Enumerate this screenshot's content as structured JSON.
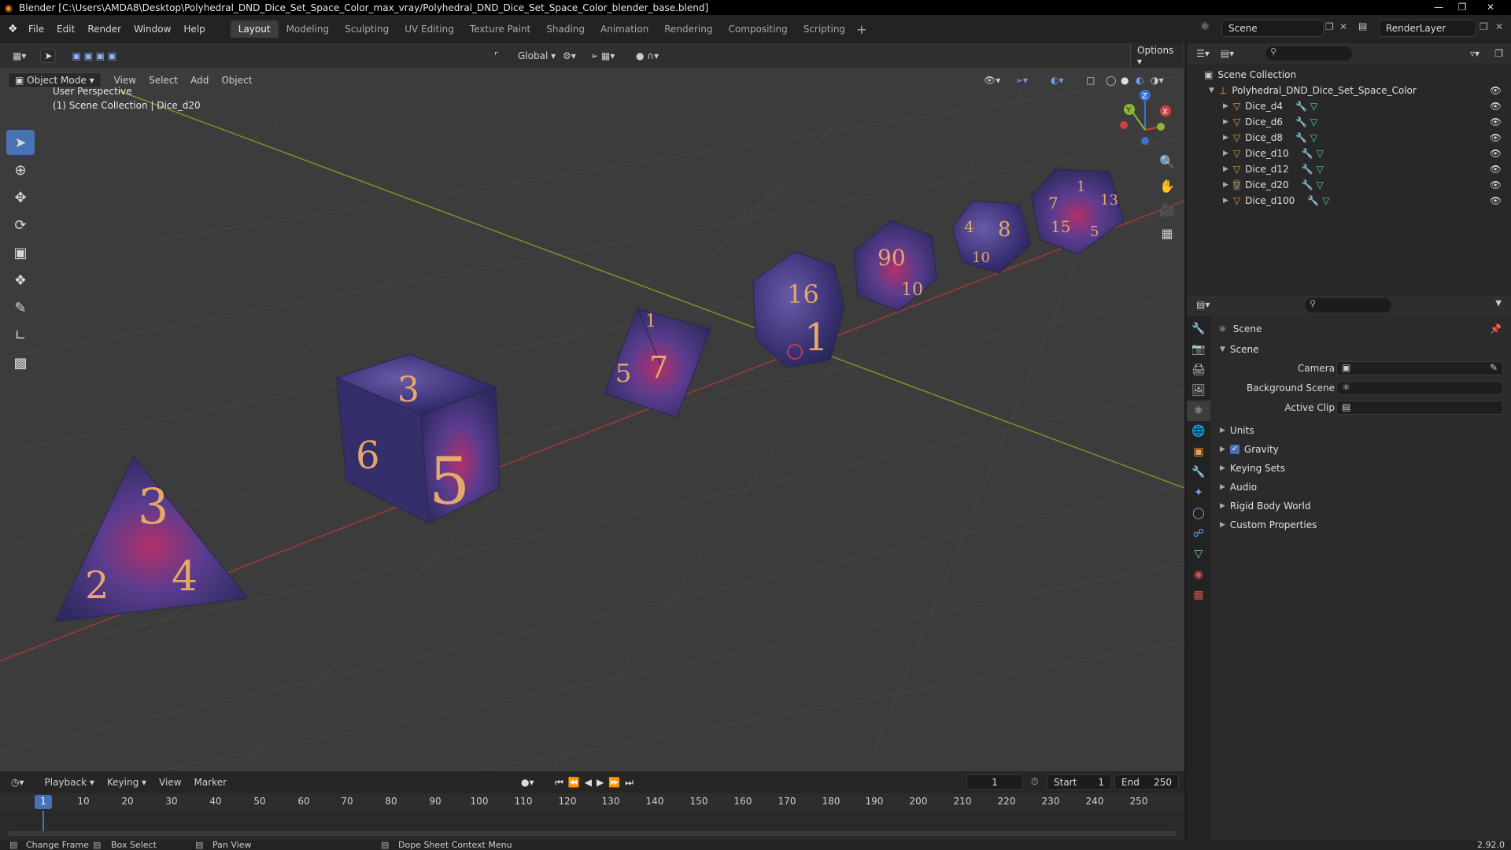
{
  "window": {
    "title": "Blender [C:\\Users\\AMDA8\\Desktop\\Polyhedral_DND_Dice_Set_Space_Color_max_vray/Polyhedral_DND_Dice_Set_Space_Color_blender_base.blend]"
  },
  "menu": {
    "items": [
      "File",
      "Edit",
      "Render",
      "Window",
      "Help"
    ]
  },
  "workspaces": [
    "Layout",
    "Modeling",
    "Sculpting",
    "UV Editing",
    "Texture Paint",
    "Shading",
    "Animation",
    "Rendering",
    "Compositing",
    "Scripting"
  ],
  "top_right": {
    "scene": "Scene",
    "view_layer": "RenderLayer"
  },
  "viewport": {
    "orientation": "Global",
    "options_label": "Options",
    "mode": "Object Mode",
    "header_menus": [
      "View",
      "Select",
      "Add",
      "Object"
    ],
    "perspective": "User Perspective",
    "collection_info": "(1) Scene Collection | Dice_d20"
  },
  "dice_labels": {
    "d4": [
      "3",
      "2",
      "4"
    ],
    "d6": [
      "3",
      "6",
      "5"
    ],
    "d8": [
      "1",
      "5",
      "7"
    ],
    "d20": [
      "16",
      "1"
    ],
    "d10": [
      "90",
      "10"
    ],
    "d12": [
      "4",
      "8",
      "10"
    ],
    "d100": [
      "1",
      "7",
      "15",
      "5",
      "13"
    ]
  },
  "gizmo": {
    "z": "Z",
    "y": "Y",
    "x": "X"
  },
  "outliner": {
    "root": "Scene Collection",
    "collection": "Polyhedral_DND_Dice_Set_Space_Color",
    "objects": [
      "Dice_d4",
      "Dice_d6",
      "Dice_d8",
      "Dice_d10",
      "Dice_d12",
      "Dice_d20",
      "Dice_d100"
    ]
  },
  "properties": {
    "context": "Scene",
    "panel": "Scene",
    "camera_label": "Camera",
    "background_label": "Background Scene",
    "clip_label": "Active Clip",
    "subpanels": [
      "Units",
      "Gravity",
      "Keying Sets",
      "Audio",
      "Rigid Body World",
      "Custom Properties"
    ]
  },
  "timeline": {
    "menus": [
      "Playback",
      "Keying",
      "View",
      "Marker"
    ],
    "current_frame": "1",
    "start_label": "Start",
    "start": "1",
    "end_label": "End",
    "end": "250",
    "ticks": [
      "1",
      "10",
      "20",
      "30",
      "40",
      "50",
      "60",
      "70",
      "80",
      "90",
      "100",
      "110",
      "120",
      "130",
      "140",
      "150",
      "160",
      "170",
      "180",
      "190",
      "200",
      "210",
      "220",
      "230",
      "240",
      "250"
    ]
  },
  "status": {
    "change_frame": "Change Frame",
    "box_select": "Box Select",
    "pan_view": "Pan View",
    "context_menu": "Dope Sheet Context Menu",
    "version": "2.92.0"
  },
  "colors": {
    "accent": "#4772b3",
    "x_axis": "#d04040",
    "y_axis": "#8ab832",
    "dice_main": "#3a3470",
    "dice_glow": "#b2306a",
    "numerals": "#e6a868"
  }
}
